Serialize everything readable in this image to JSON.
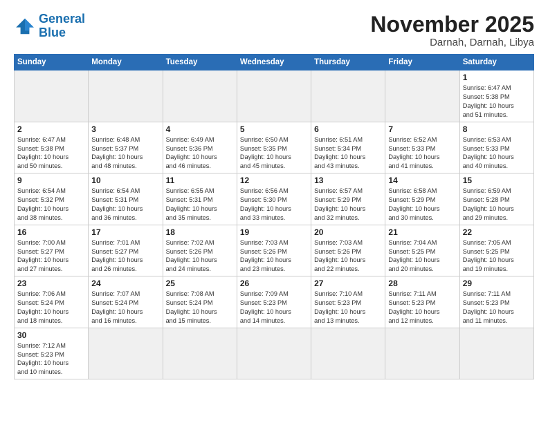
{
  "logo": {
    "line1": "General",
    "line2": "Blue"
  },
  "title": "November 2025",
  "location": "Darnah, Darnah, Libya",
  "weekdays": [
    "Sunday",
    "Monday",
    "Tuesday",
    "Wednesday",
    "Thursday",
    "Friday",
    "Saturday"
  ],
  "weeks": [
    [
      {
        "day": "",
        "info": ""
      },
      {
        "day": "",
        "info": ""
      },
      {
        "day": "",
        "info": ""
      },
      {
        "day": "",
        "info": ""
      },
      {
        "day": "",
        "info": ""
      },
      {
        "day": "",
        "info": ""
      },
      {
        "day": "1",
        "info": "Sunrise: 6:47 AM\nSunset: 5:38 PM\nDaylight: 10 hours\nand 51 minutes."
      }
    ],
    [
      {
        "day": "2",
        "info": "Sunrise: 6:47 AM\nSunset: 5:38 PM\nDaylight: 10 hours\nand 50 minutes."
      },
      {
        "day": "3",
        "info": "Sunrise: 6:48 AM\nSunset: 5:37 PM\nDaylight: 10 hours\nand 48 minutes."
      },
      {
        "day": "4",
        "info": "Sunrise: 6:49 AM\nSunset: 5:36 PM\nDaylight: 10 hours\nand 46 minutes."
      },
      {
        "day": "5",
        "info": "Sunrise: 6:50 AM\nSunset: 5:35 PM\nDaylight: 10 hours\nand 45 minutes."
      },
      {
        "day": "6",
        "info": "Sunrise: 6:51 AM\nSunset: 5:34 PM\nDaylight: 10 hours\nand 43 minutes."
      },
      {
        "day": "7",
        "info": "Sunrise: 6:52 AM\nSunset: 5:33 PM\nDaylight: 10 hours\nand 41 minutes."
      },
      {
        "day": "8",
        "info": "Sunrise: 6:53 AM\nSunset: 5:33 PM\nDaylight: 10 hours\nand 40 minutes."
      }
    ],
    [
      {
        "day": "9",
        "info": "Sunrise: 6:54 AM\nSunset: 5:32 PM\nDaylight: 10 hours\nand 38 minutes."
      },
      {
        "day": "10",
        "info": "Sunrise: 6:54 AM\nSunset: 5:31 PM\nDaylight: 10 hours\nand 36 minutes."
      },
      {
        "day": "11",
        "info": "Sunrise: 6:55 AM\nSunset: 5:31 PM\nDaylight: 10 hours\nand 35 minutes."
      },
      {
        "day": "12",
        "info": "Sunrise: 6:56 AM\nSunset: 5:30 PM\nDaylight: 10 hours\nand 33 minutes."
      },
      {
        "day": "13",
        "info": "Sunrise: 6:57 AM\nSunset: 5:29 PM\nDaylight: 10 hours\nand 32 minutes."
      },
      {
        "day": "14",
        "info": "Sunrise: 6:58 AM\nSunset: 5:29 PM\nDaylight: 10 hours\nand 30 minutes."
      },
      {
        "day": "15",
        "info": "Sunrise: 6:59 AM\nSunset: 5:28 PM\nDaylight: 10 hours\nand 29 minutes."
      }
    ],
    [
      {
        "day": "16",
        "info": "Sunrise: 7:00 AM\nSunset: 5:27 PM\nDaylight: 10 hours\nand 27 minutes."
      },
      {
        "day": "17",
        "info": "Sunrise: 7:01 AM\nSunset: 5:27 PM\nDaylight: 10 hours\nand 26 minutes."
      },
      {
        "day": "18",
        "info": "Sunrise: 7:02 AM\nSunset: 5:26 PM\nDaylight: 10 hours\nand 24 minutes."
      },
      {
        "day": "19",
        "info": "Sunrise: 7:03 AM\nSunset: 5:26 PM\nDaylight: 10 hours\nand 23 minutes."
      },
      {
        "day": "20",
        "info": "Sunrise: 7:03 AM\nSunset: 5:26 PM\nDaylight: 10 hours\nand 22 minutes."
      },
      {
        "day": "21",
        "info": "Sunrise: 7:04 AM\nSunset: 5:25 PM\nDaylight: 10 hours\nand 20 minutes."
      },
      {
        "day": "22",
        "info": "Sunrise: 7:05 AM\nSunset: 5:25 PM\nDaylight: 10 hours\nand 19 minutes."
      }
    ],
    [
      {
        "day": "23",
        "info": "Sunrise: 7:06 AM\nSunset: 5:24 PM\nDaylight: 10 hours\nand 18 minutes."
      },
      {
        "day": "24",
        "info": "Sunrise: 7:07 AM\nSunset: 5:24 PM\nDaylight: 10 hours\nand 16 minutes."
      },
      {
        "day": "25",
        "info": "Sunrise: 7:08 AM\nSunset: 5:24 PM\nDaylight: 10 hours\nand 15 minutes."
      },
      {
        "day": "26",
        "info": "Sunrise: 7:09 AM\nSunset: 5:23 PM\nDaylight: 10 hours\nand 14 minutes."
      },
      {
        "day": "27",
        "info": "Sunrise: 7:10 AM\nSunset: 5:23 PM\nDaylight: 10 hours\nand 13 minutes."
      },
      {
        "day": "28",
        "info": "Sunrise: 7:11 AM\nSunset: 5:23 PM\nDaylight: 10 hours\nand 12 minutes."
      },
      {
        "day": "29",
        "info": "Sunrise: 7:11 AM\nSunset: 5:23 PM\nDaylight: 10 hours\nand 11 minutes."
      }
    ],
    [
      {
        "day": "30",
        "info": "Sunrise: 7:12 AM\nSunset: 5:23 PM\nDaylight: 10 hours\nand 10 minutes."
      },
      {
        "day": "",
        "info": ""
      },
      {
        "day": "",
        "info": ""
      },
      {
        "day": "",
        "info": ""
      },
      {
        "day": "",
        "info": ""
      },
      {
        "day": "",
        "info": ""
      },
      {
        "day": "",
        "info": ""
      }
    ]
  ]
}
